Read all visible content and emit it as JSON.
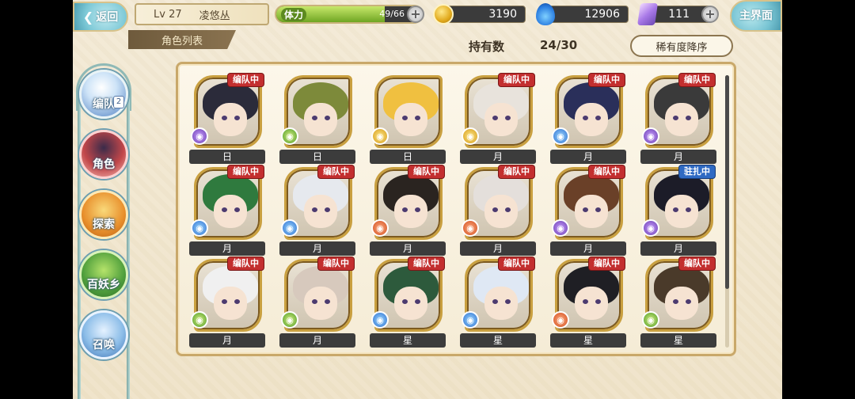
{
  "header": {
    "back_label": "返回",
    "level": "Lv 27",
    "player_name": "凌悠丛",
    "stamina_label": "体力",
    "stamina_value": "49/66",
    "stamina_fraction": 0.742,
    "gold": "3190",
    "soul": "12906",
    "gems": "111",
    "main_label": "主界面"
  },
  "subheader": {
    "tab_label": "角色列表",
    "owned_label": "持有数",
    "owned_value": "24/30",
    "sort_label": "稀有度降序"
  },
  "side_menu": [
    {
      "label": "编队",
      "icon": "formation-icon",
      "badge": "2"
    },
    {
      "label": "角色",
      "icon": "character-icon"
    },
    {
      "label": "探索",
      "icon": "explore-icon"
    },
    {
      "label": "百妖乡",
      "icon": "village-icon"
    },
    {
      "label": "召唤",
      "icon": "summon-icon"
    }
  ],
  "characters": [
    {
      "tag": "编队中",
      "tag_color": "red",
      "element": "purple",
      "rank": "日",
      "hair": "#2b2b3a"
    },
    {
      "tag": "",
      "tag_color": "red",
      "element": "green",
      "rank": "日",
      "hair": "#7d8a3a"
    },
    {
      "tag": "",
      "tag_color": "red",
      "element": "gold",
      "rank": "日",
      "hair": "#f0c040"
    },
    {
      "tag": "编队中",
      "tag_color": "red",
      "element": "gold",
      "rank": "月",
      "hair": "#e8e3dc"
    },
    {
      "tag": "编队中",
      "tag_color": "red",
      "element": "blue",
      "rank": "月",
      "hair": "#2a2f5a"
    },
    {
      "tag": "编队中",
      "tag_color": "red",
      "element": "purple",
      "rank": "月",
      "hair": "#3a3a3a"
    },
    {
      "tag": "编队中",
      "tag_color": "red",
      "element": "blue",
      "rank": "月",
      "hair": "#2f7a3e"
    },
    {
      "tag": "编队中",
      "tag_color": "red",
      "element": "blue",
      "rank": "月",
      "hair": "#e6e9ee"
    },
    {
      "tag": "编队中",
      "tag_color": "red",
      "element": "red",
      "rank": "月",
      "hair": "#2a2420"
    },
    {
      "tag": "编队中",
      "tag_color": "red",
      "element": "red",
      "rank": "月",
      "hair": "#e4dfdb"
    },
    {
      "tag": "编队中",
      "tag_color": "red",
      "element": "purple",
      "rank": "月",
      "hair": "#6a4028"
    },
    {
      "tag": "驻扎中",
      "tag_color": "blue",
      "element": "purple",
      "rank": "月",
      "hair": "#1c1c28"
    },
    {
      "tag": "编队中",
      "tag_color": "red",
      "element": "green",
      "rank": "月",
      "hair": "#f0f0f0"
    },
    {
      "tag": "编队中",
      "tag_color": "red",
      "element": "green",
      "rank": "月",
      "hair": "#d7c9bd"
    },
    {
      "tag": "编队中",
      "tag_color": "red",
      "element": "blue",
      "rank": "星",
      "hair": "#2d5a3c"
    },
    {
      "tag": "编队中",
      "tag_color": "red",
      "element": "blue",
      "rank": "星",
      "hair": "#dfe8f4"
    },
    {
      "tag": "编队中",
      "tag_color": "red",
      "element": "red",
      "rank": "星",
      "hair": "#1f1f24"
    },
    {
      "tag": "编队中",
      "tag_color": "red",
      "element": "green",
      "rank": "星",
      "hair": "#4a3a2a"
    }
  ]
}
